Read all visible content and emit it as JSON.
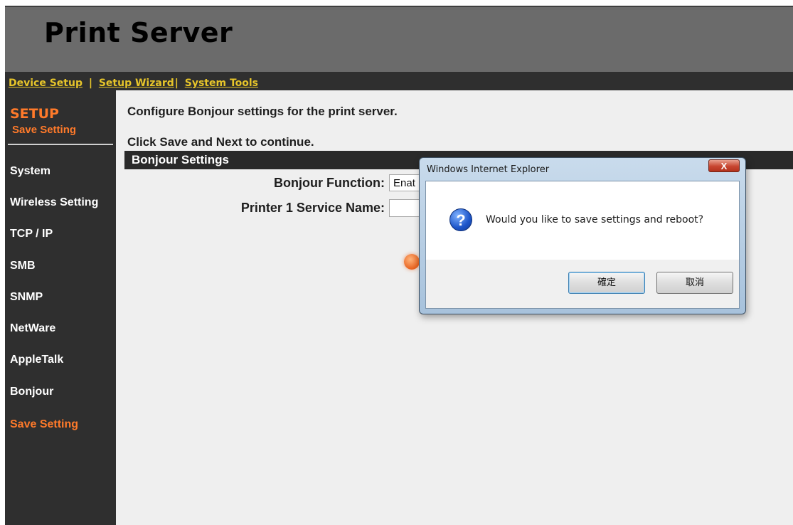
{
  "header": {
    "title": "Print Server"
  },
  "nav": {
    "device_setup": "Device Setup",
    "sep1": "|",
    "setup_wizard": "Setup Wizard",
    "sep2": "|",
    "system_tools": "System Tools"
  },
  "sidebar": {
    "title": "SETUP",
    "subtitle": "Save Setting",
    "items": [
      {
        "label": "System"
      },
      {
        "label": "Wireless Setting"
      },
      {
        "label": "TCP / IP"
      },
      {
        "label": "SMB"
      },
      {
        "label": "SNMP"
      },
      {
        "label": "NetWare"
      },
      {
        "label": "AppleTalk"
      },
      {
        "label": "Bonjour"
      },
      {
        "label": "Save Setting"
      }
    ]
  },
  "main": {
    "intro": "Configure Bonjour settings for the print server.",
    "instruction": "Click Save and Next to continue.",
    "section_title": "Bonjour Settings",
    "bonjour_function_label": "Bonjour Function:",
    "bonjour_function_value": "Enat",
    "service_name_label": "Printer 1 Service Name:",
    "service_name_value": ""
  },
  "dialog": {
    "title": "Windows Internet Explorer",
    "close_label": "X",
    "message": "Would you like to save settings and reboot?",
    "ok_label": "確定",
    "cancel_label": "取消",
    "icon": "question-icon"
  },
  "colors": {
    "header_bg": "#6b6b6b",
    "nav_bg": "#2f2f2f",
    "nav_link": "#e7c52a",
    "accent": "#ff7a2a",
    "content_bg": "#efefef"
  }
}
